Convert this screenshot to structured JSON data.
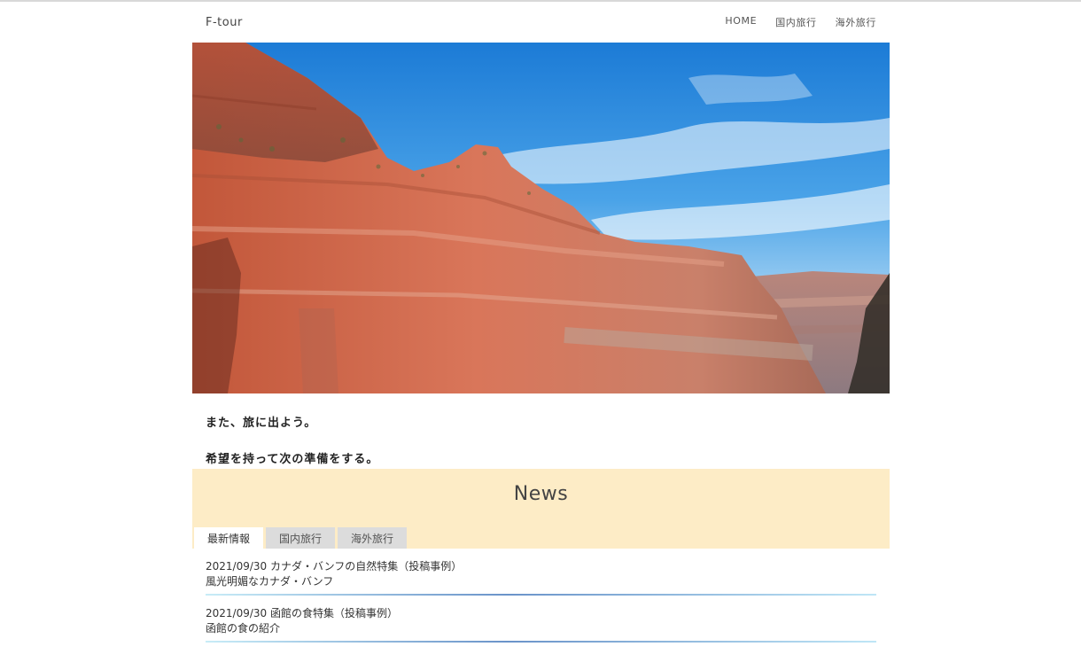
{
  "header": {
    "logo": "F-tour",
    "nav": [
      {
        "label": "HOME"
      },
      {
        "label": "国内旅行"
      },
      {
        "label": "海外旅行"
      }
    ]
  },
  "tagline": {
    "line1": "また、旅に出よう。",
    "line2": "希望を持って次の準備をする。"
  },
  "news": {
    "title": "News",
    "tabs": [
      {
        "label": "最新情報"
      },
      {
        "label": "国内旅行"
      },
      {
        "label": "海外旅行"
      }
    ],
    "items": [
      {
        "date": "2021/09/30",
        "title": "カナダ・バンフの自然特集（投稿事例）",
        "subtitle": "風光明媚なカナダ・バンフ"
      },
      {
        "date": "2021/09/30",
        "title": "函館の食特集（投稿事例）",
        "subtitle": "函館の食の紹介"
      }
    ]
  },
  "colors": {
    "news_background": "#fdecc6",
    "tab_inactive": "#dcdcdc",
    "tab_active": "#ffffff"
  }
}
